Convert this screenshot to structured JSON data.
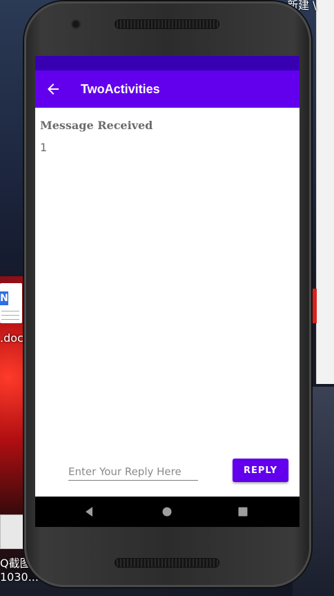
{
  "desktop": {
    "top_right_label": "新建 \\",
    "doc_label": ".doc",
    "screenshot_label_1": "Q截图",
    "screenshot_label_2": "1030...",
    "doc_badge": "N"
  },
  "app": {
    "title": "TwoActivities",
    "message_heading": "Message Received",
    "message_value": "1",
    "reply_placeholder": "Enter Your Reply Here",
    "reply_value": "",
    "reply_button": "REPLY"
  },
  "colors": {
    "status_bar": "#3700b3",
    "app_bar": "#6200ee",
    "button": "#6200ee"
  },
  "icons": {
    "back": "arrow-left",
    "nav_back": "triangle-left",
    "nav_home": "circle",
    "nav_recents": "square"
  }
}
